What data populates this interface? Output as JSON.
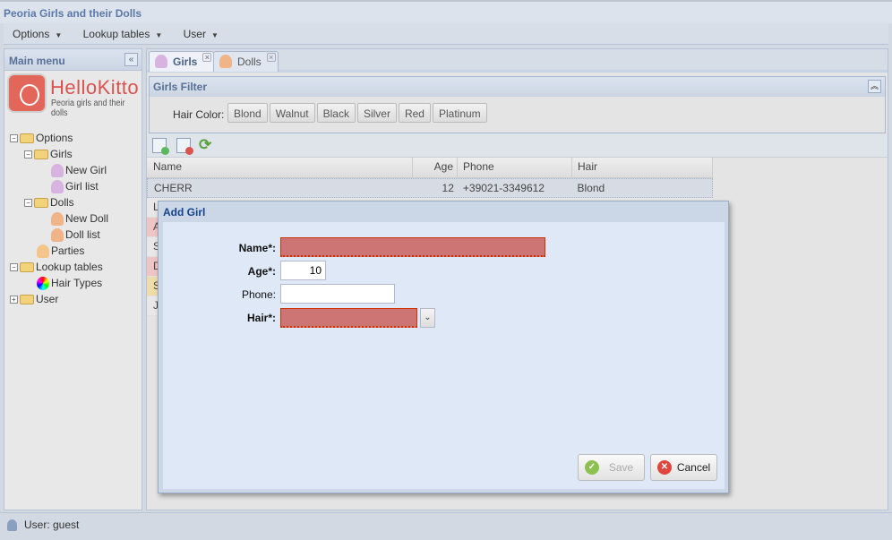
{
  "app": {
    "title": "Peoria Girls and their Dolls"
  },
  "menubar": [
    {
      "label": "Options"
    },
    {
      "label": "Lookup tables"
    },
    {
      "label": "User"
    }
  ],
  "left_panel": {
    "title": "Main menu",
    "logo": {
      "name": "HelloKitto",
      "subtitle": "Peoria girls and their dolls"
    },
    "tree": [
      {
        "label": "Options",
        "icon": "folder-icon"
      },
      {
        "label": "Girls",
        "icon": "folder-icon"
      },
      {
        "label": "New Girl",
        "icon": "add-girl-icon"
      },
      {
        "label": "Girl list",
        "icon": "girl-icon"
      },
      {
        "label": "Dolls",
        "icon": "folder-icon"
      },
      {
        "label": "New Doll",
        "icon": "add-doll-icon"
      },
      {
        "label": "Doll list",
        "icon": "doll-icon"
      },
      {
        "label": "Parties",
        "icon": "cake-icon"
      },
      {
        "label": "Lookup tables",
        "icon": "folder-icon"
      },
      {
        "label": "Hair Types",
        "icon": "color-wheel-icon"
      },
      {
        "label": "User",
        "icon": "folder-icon"
      }
    ]
  },
  "tabs": [
    {
      "label": "Girls",
      "active": true
    },
    {
      "label": "Dolls",
      "active": false
    }
  ],
  "filter": {
    "title": "Girls Filter",
    "label": "Hair Color:",
    "options": [
      "Blond",
      "Walnut",
      "Black",
      "Silver",
      "Red",
      "Platinum"
    ]
  },
  "grid": {
    "columns": [
      "Name",
      "Age",
      "Phone",
      "Hair"
    ],
    "rows": [
      {
        "name": "CHERR",
        "age": "12",
        "phone": "+39021-3349612",
        "hair": "Blond",
        "selected": true
      },
      {
        "name": "L",
        "age": "",
        "phone": "",
        "hair": "",
        "bg": "#e8e8e8"
      },
      {
        "name": "A",
        "age": "",
        "phone": "",
        "hair": "",
        "bg": "#efc4c4"
      },
      {
        "name": "S",
        "age": "",
        "phone": "",
        "hair": "",
        "bg": "#e8e8e8"
      },
      {
        "name": "D",
        "age": "",
        "phone": "",
        "hair": "",
        "bg": "#efc4c4"
      },
      {
        "name": "S",
        "age": "",
        "phone": "",
        "hair": "",
        "bg": "#eedcaa"
      },
      {
        "name": "J",
        "age": "",
        "phone": "",
        "hair": "",
        "bg": "#e8e8e8"
      }
    ]
  },
  "dialog": {
    "title": "Add Girl",
    "fields": {
      "name_label": "Name*:",
      "name_value": "",
      "age_label": "Age*:",
      "age_value": "10",
      "phone_label": "Phone:",
      "phone_value": "",
      "hair_label": "Hair*:",
      "hair_value": ""
    },
    "save_label": "Save",
    "cancel_label": "Cancel"
  },
  "status": {
    "text": "User: guest"
  },
  "colors": {
    "accent": "#15428b",
    "invalid": "#cd7474"
  }
}
